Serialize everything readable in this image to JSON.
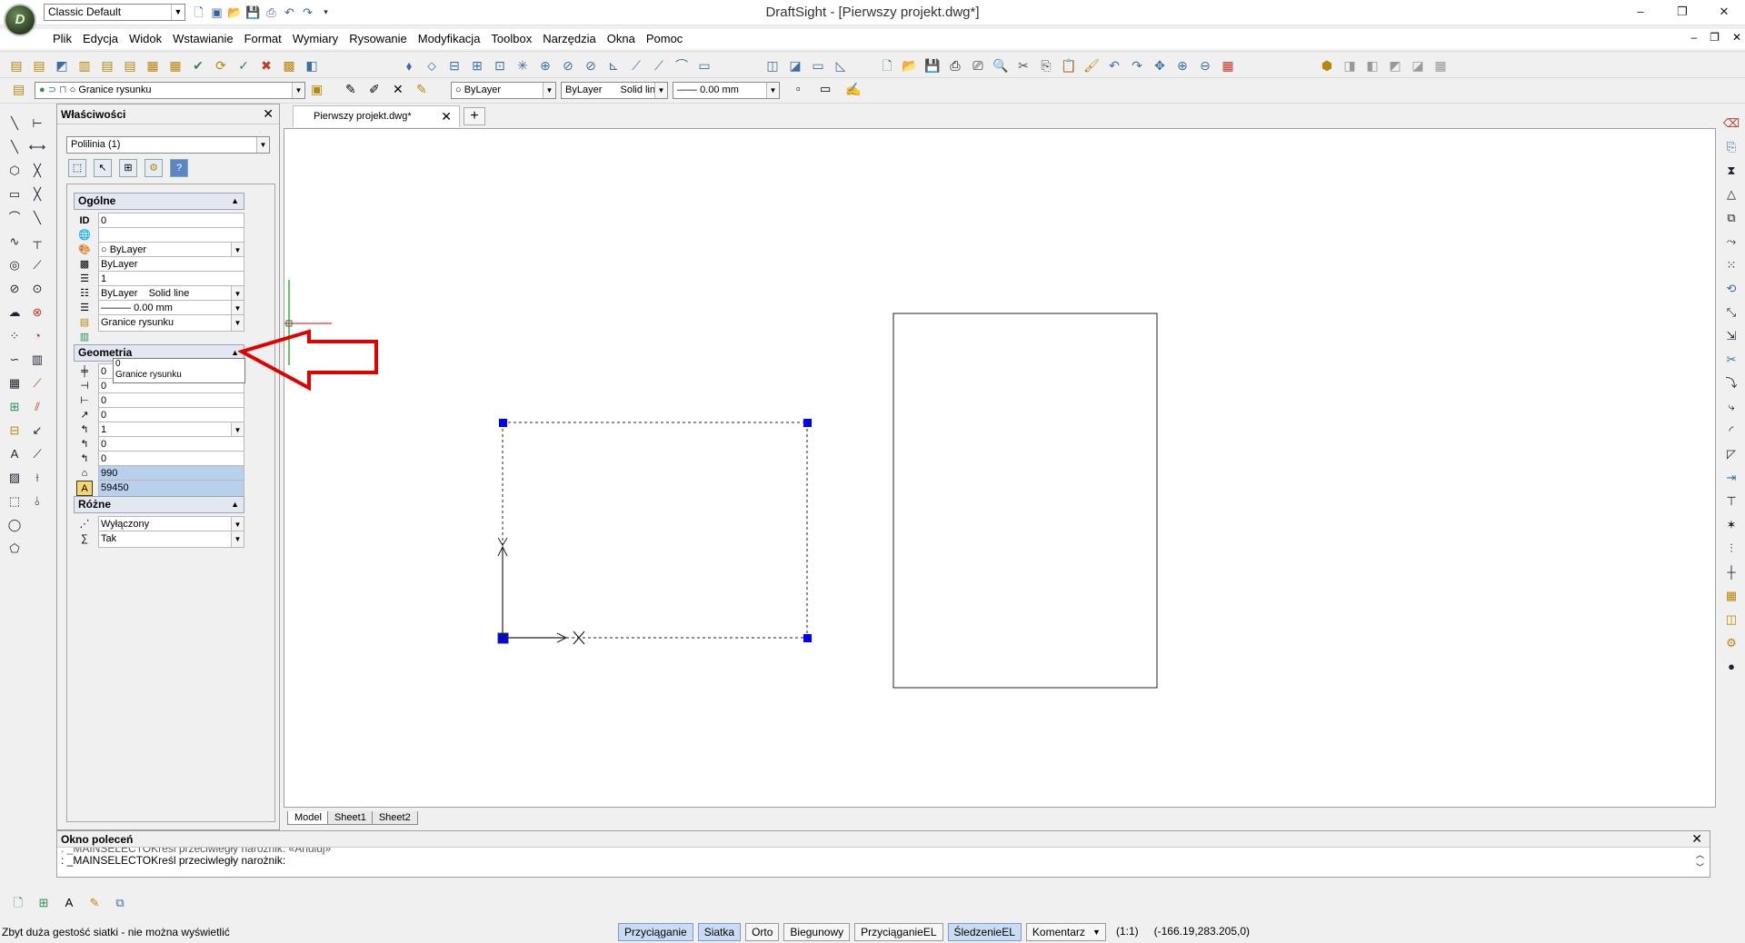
{
  "title_bar": {
    "workspace": "Classic Default",
    "window_title": "DraftSight - [Pierwszy projekt.dwg*]"
  },
  "menu": {
    "items": [
      "Plik",
      "Edycja",
      "Widok",
      "Wstawianie",
      "Format",
      "Wymiary",
      "Rysowanie",
      "Modyfikacja",
      "Toolbox",
      "Narzędzia",
      "Okna",
      "Pomoc"
    ]
  },
  "layer_toolbar": {
    "layer": "Granice rysunku",
    "color": "ByLayer",
    "linestyle_by": "ByLayer",
    "linestyle_name": "Solid line",
    "lineweight": "0.00 mm"
  },
  "properties": {
    "title": "Właściwości",
    "entity_selector": "Polilinia (1)",
    "sections": {
      "general": "Ogólne",
      "geometry": "Geometria",
      "misc": "Różne"
    },
    "general_rows": [
      "0",
      "",
      "ByLayer",
      "ByLayer",
      "1",
      "ByLayer    Solid line",
      "0.00 mm",
      "Granice rysunku"
    ],
    "layer_dropdown_options": [
      "0",
      "Granice rysunku"
    ],
    "geometry_rows": [
      "0",
      "0",
      "0",
      "0",
      "1",
      "0",
      "0",
      "990",
      "59450"
    ],
    "misc_rows": [
      "Wyłączony",
      "Tak"
    ]
  },
  "document": {
    "tab_name": "Pierwszy projekt.dwg*",
    "layout_tabs": [
      "Model",
      "Sheet1",
      "Sheet2"
    ]
  },
  "command_window": {
    "title": "Okno poleceń",
    "line_prev": ": _MAINSELECTOKreśl przeciwległy narożnik: «Anuluj»",
    "line_current": ": _MAINSELECTOKreśl przeciwległy narożnik:"
  },
  "status_bar": {
    "message": "Zbyt duża gestość siatki - nie można wyświetlić",
    "buttons": [
      "Przyciąganie",
      "Siatka",
      "Orto",
      "Biegunowy",
      "PrzyciąganieEL",
      "ŚledzenieEL"
    ],
    "active_buttons": [
      "Przyciąganie",
      "Siatka",
      "ŚledzenieEL"
    ],
    "annotation": "Komentarz",
    "scale": "(1:1)",
    "coordinates": "(-166.19,283.205,0)"
  },
  "colors": {
    "grip": "#0000ff",
    "annotation_arrow": "#e00000",
    "ucs_green": "#2db52d",
    "active_status": "#c9dcf2"
  },
  "icons": {
    "app_logo": "draftsight-logo",
    "left_tools": [
      "line-icon",
      "construction-line-icon",
      "polygon-icon",
      "rectangle-icon",
      "arc-icon",
      "spline-icon",
      "circle-icon",
      "ellipse-icon",
      "cloud-icon",
      "points-icon",
      "hatch-icon",
      "block-icon",
      "note-icon"
    ],
    "right_tools": [
      "eraser-icon",
      "copy-icon",
      "mirror-icon",
      "offset-icon",
      "pattern-icon",
      "move-icon",
      "rotate-icon",
      "scale-icon",
      "stretch-icon",
      "trim-icon",
      "extend-icon",
      "break-icon",
      "fillet-icon",
      "chamfer-icon",
      "explode-icon"
    ]
  }
}
